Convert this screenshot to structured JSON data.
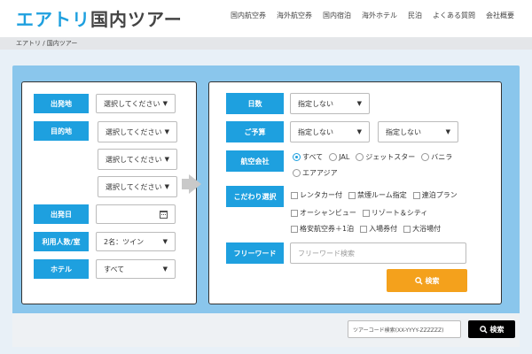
{
  "header": {
    "logo_brand": "エアトリ",
    "logo_suffix": "国内ツアー",
    "nav": [
      "国内航空券",
      "海外航空券",
      "国内宿泊",
      "海外ホテル",
      "民泊",
      "よくある質問",
      "会社概要"
    ]
  },
  "breadcrumb": "エアトリ / 国内ツアー",
  "left": {
    "departure_label": "出発地",
    "departure_value": "選択してください",
    "destination_label": "目的地",
    "destination_values": [
      "選択してください",
      "選択してください",
      "選択してください"
    ],
    "date_label": "出発日",
    "date_value": "",
    "people_label": "利用人数/室",
    "people_value": "2名：ツイン",
    "hotel_label": "ホテル",
    "hotel_value": "すべて"
  },
  "right": {
    "days_label": "日数",
    "days_value": "指定しない",
    "budget_label": "ご予算",
    "budget_min": "指定しない",
    "budget_max": "指定しない",
    "airline_label": "航空会社",
    "airlines": [
      {
        "label": "すべて",
        "checked": true
      },
      {
        "label": "JAL",
        "checked": false
      },
      {
        "label": "ジェットスター",
        "checked": false
      },
      {
        "label": "バニラ",
        "checked": false
      },
      {
        "label": "エアアジア",
        "checked": false
      }
    ],
    "preference_label": "こだわり選択",
    "preferences": [
      [
        "レンタカー付",
        "禁煙ルーム指定",
        "連泊プラン"
      ],
      [
        "オーシャンビュー",
        "リゾート＆シティ"
      ],
      [
        "格安航空券＋1泊",
        "入場券付",
        "大浴場付"
      ]
    ],
    "freeword_label": "フリーワード",
    "freeword_placeholder": "フリーワード検索",
    "search_button": "検索"
  },
  "footer": {
    "tour_code_placeholder": "ツアーコード検索(XX-YYYY-ZZZZZZ)",
    "search_button": "検索"
  },
  "icons": {
    "caret": "▼",
    "search": "search-icon",
    "calendar": "calendar-icon"
  },
  "colors": {
    "accent": "#1ea0df",
    "panel": "#8ac6ec",
    "orange": "#f4a11c"
  }
}
